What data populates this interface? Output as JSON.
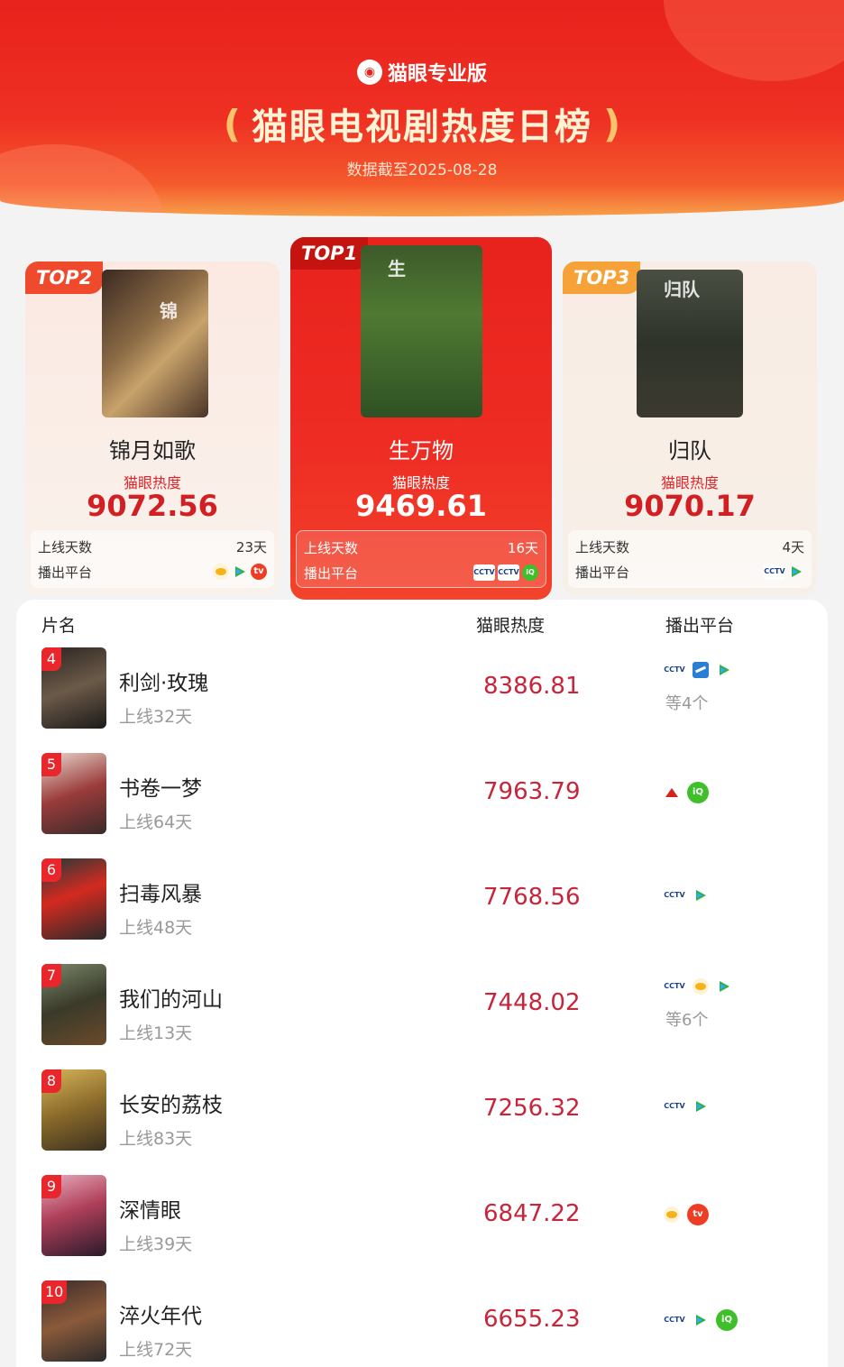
{
  "header": {
    "brand": "猫眼专业版",
    "title": "猫眼电视剧热度日榜",
    "date_prefix": "数据截至",
    "date": "2025-08-28"
  },
  "top3": [
    {
      "rank_label": "TOP1",
      "name": "生万物",
      "heat_label": "猫眼热度",
      "heat": "9469.61",
      "days_label": "上线天数",
      "days": "16天",
      "platform_label": "播出平台",
      "platforms": [
        "cctv-icon",
        "cctv-icon",
        "iqiyi-icon"
      ]
    },
    {
      "rank_label": "TOP2",
      "name": "锦月如歌",
      "heat_label": "猫眼热度",
      "heat": "9072.56",
      "days_label": "上线天数",
      "days": "23天",
      "platform_label": "播出平台",
      "platforms": [
        "mango-icon",
        "tencent-video-icon",
        "mgtv-icon"
      ]
    },
    {
      "rank_label": "TOP3",
      "name": "归队",
      "heat_label": "猫眼热度",
      "heat": "9070.17",
      "days_label": "上线天数",
      "days": "4天",
      "platform_label": "播出平台",
      "platforms": [
        "cctv-icon",
        "tencent-video-icon"
      ]
    }
  ],
  "list": {
    "headers": {
      "name": "片名",
      "heat": "猫眼热度",
      "platform": "播出平台"
    },
    "rows": [
      {
        "rank": "4",
        "name": "利剑·玫瑰",
        "days": "上线32天",
        "heat": "8386.81",
        "platforms": [
          "cctv-icon",
          "zhejiang-tv-icon",
          "tencent-video-icon"
        ],
        "more": "等4个"
      },
      {
        "rank": "5",
        "name": "书卷一梦",
        "days": "上线64天",
        "heat": "7963.79",
        "platforms": [
          "jiangsu-tv-icon",
          "iqiyi-icon"
        ],
        "more": ""
      },
      {
        "rank": "6",
        "name": "扫毒风暴",
        "days": "上线48天",
        "heat": "7768.56",
        "platforms": [
          "cctv-icon",
          "tencent-video-icon"
        ],
        "more": ""
      },
      {
        "rank": "7",
        "name": "我们的河山",
        "days": "上线13天",
        "heat": "7448.02",
        "platforms": [
          "cctv-icon",
          "mango-icon",
          "tencent-video-icon"
        ],
        "more": "等6个"
      },
      {
        "rank": "8",
        "name": "长安的荔枝",
        "days": "上线83天",
        "heat": "7256.32",
        "platforms": [
          "cctv-icon",
          "tencent-video-icon"
        ],
        "more": ""
      },
      {
        "rank": "9",
        "name": "深情眼",
        "days": "上线39天",
        "heat": "6847.22",
        "platforms": [
          "mango-icon",
          "mgtv-icon"
        ],
        "more": ""
      },
      {
        "rank": "10",
        "name": "淬火年代",
        "days": "上线72天",
        "heat": "6655.23",
        "platforms": [
          "cctv-icon",
          "tencent-video-icon",
          "iqiyi-icon"
        ],
        "more": ""
      }
    ]
  },
  "colors": {
    "brand_red": "#e8221d",
    "heat_red": "#c8243a",
    "gold": "#f6a238"
  }
}
